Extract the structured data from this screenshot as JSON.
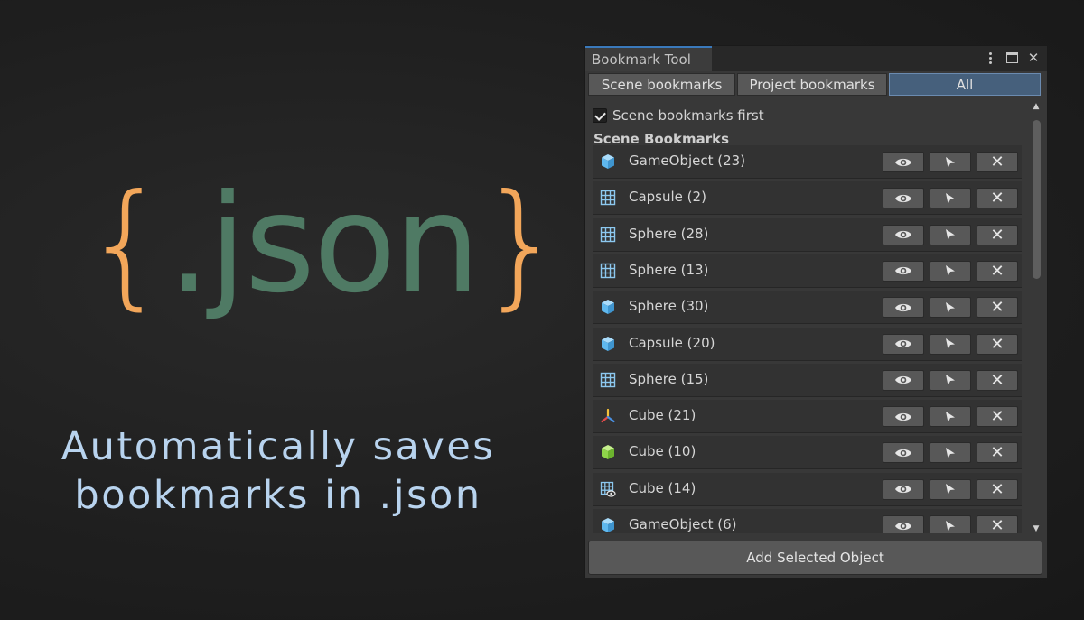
{
  "promo": {
    "brace_open": "{",
    "word": ".json",
    "brace_close": "}",
    "tagline_line1": "Automatically saves",
    "tagline_line2": "bookmarks in .json"
  },
  "window": {
    "title": "Bookmark Tool",
    "menu_icon": "kebab-menu-icon",
    "maximize_icon": "maximize-icon",
    "close_icon": "close-icon",
    "close_glyph": "✕"
  },
  "filter_tabs": [
    {
      "label": "Scene bookmarks",
      "active": false
    },
    {
      "label": "Project bookmarks",
      "active": false
    },
    {
      "label": "All",
      "active": true
    }
  ],
  "options": {
    "scene_first_label": "Scene bookmarks first",
    "scene_first_checked": true
  },
  "section": {
    "title": "Scene Bookmarks"
  },
  "row_actions": {
    "view_icon": "eye-icon",
    "select_icon": "cursor-arrow-icon",
    "remove_icon": "close-icon",
    "remove_glyph": "✕"
  },
  "bookmarks": [
    {
      "label": "GameObject (23)",
      "icon": "gameobject-cube-icon"
    },
    {
      "label": "Capsule (2)",
      "icon": "grid-icon"
    },
    {
      "label": "Sphere (28)",
      "icon": "grid-icon"
    },
    {
      "label": "Sphere (13)",
      "icon": "grid-icon"
    },
    {
      "label": "Sphere (30)",
      "icon": "gameobject-cube-icon"
    },
    {
      "label": "Capsule (20)",
      "icon": "gameobject-cube-icon"
    },
    {
      "label": "Sphere (15)",
      "icon": "grid-icon"
    },
    {
      "label": "Cube (21)",
      "icon": "transform-axes-icon"
    },
    {
      "label": "Cube (10)",
      "icon": "green-cube-icon"
    },
    {
      "label": "Cube (14)",
      "icon": "grid-eye-icon"
    },
    {
      "label": "GameObject (6)",
      "icon": "gameobject-cube-icon"
    }
  ],
  "footer": {
    "add_button_label": "Add Selected Object"
  },
  "colors": {
    "accent_blue": "#3a79bb",
    "active_tab": "#46607c",
    "brace_orange": "#f2a65a",
    "word_green": "#4f7a64",
    "tagline_blue": "#b8d3ee",
    "cube_blue": "#5fb8ee",
    "cube_green": "#8fd44a"
  }
}
